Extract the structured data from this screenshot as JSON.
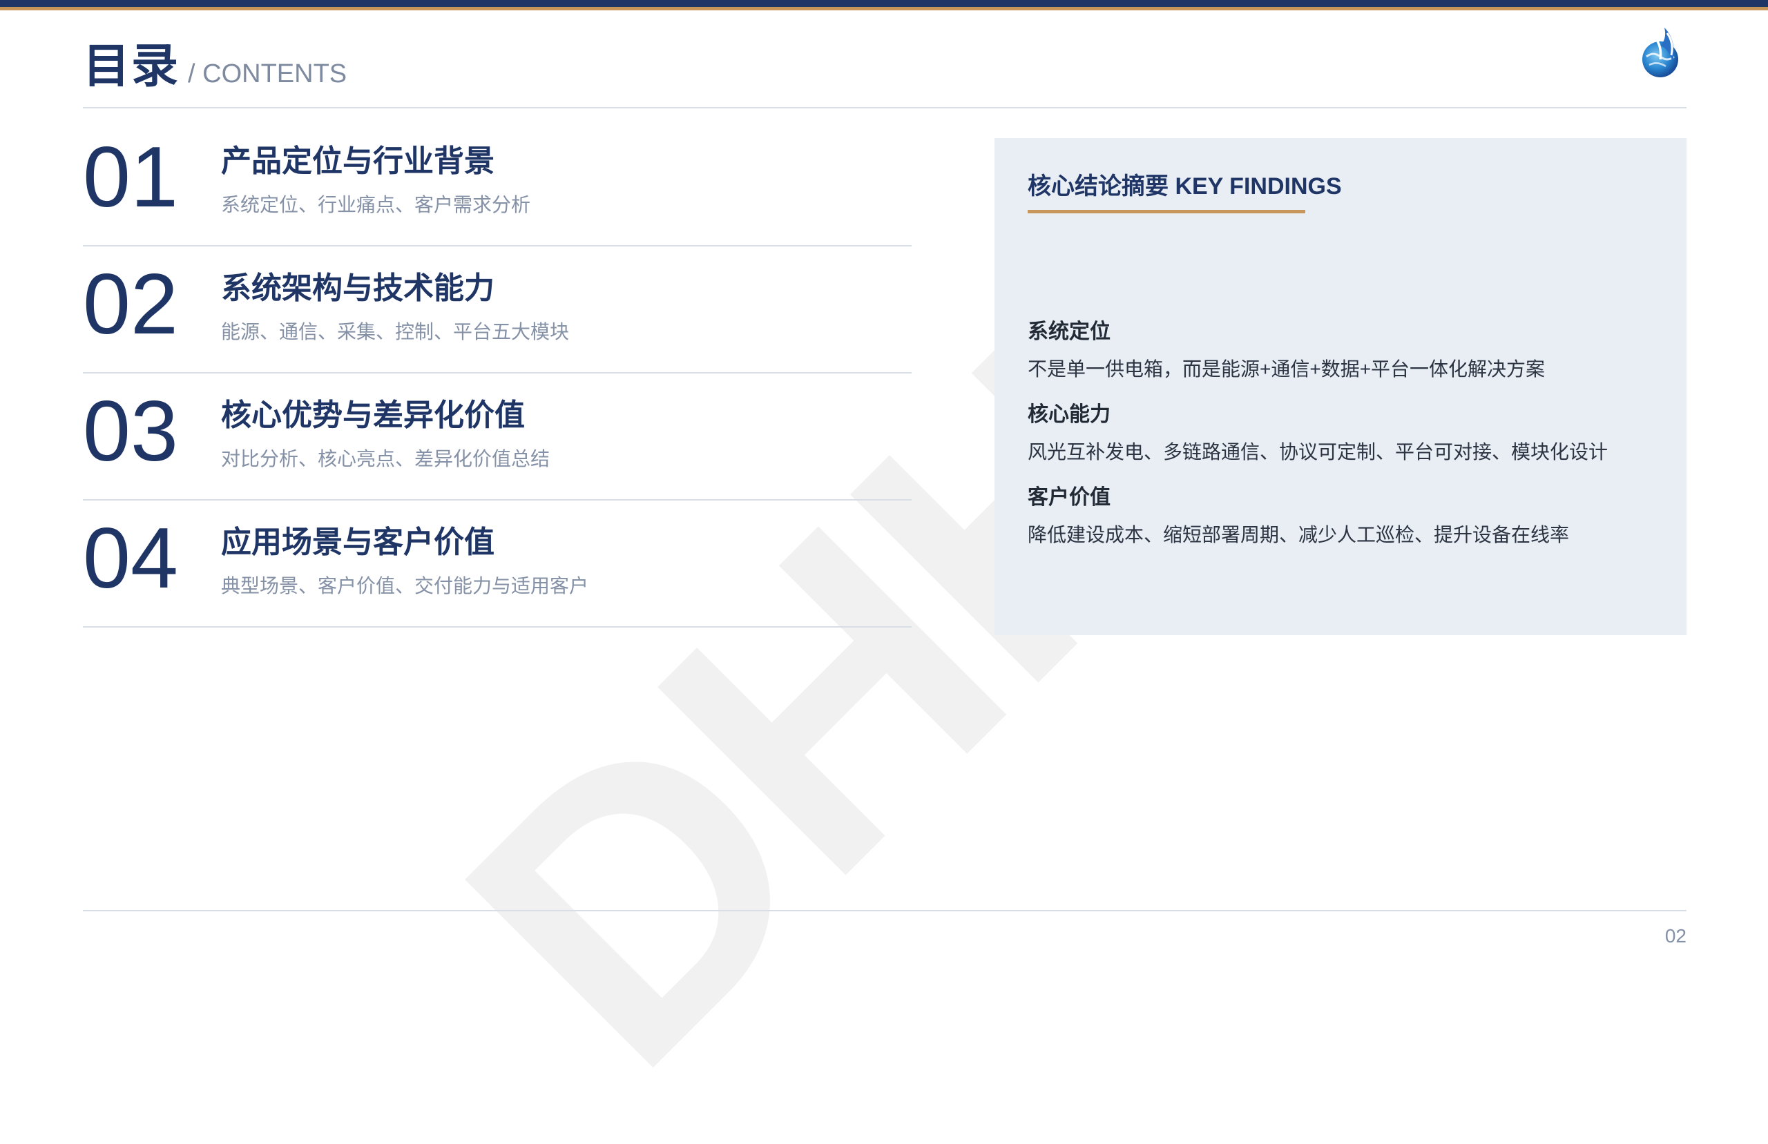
{
  "header": {
    "title": "目录",
    "subtitle": "/ CONTENTS"
  },
  "watermark": "DHHT",
  "toc": {
    "items": [
      {
        "number": "01",
        "title": "产品定位与行业背景",
        "desc": "系统定位、行业痛点、客户需求分析"
      },
      {
        "number": "02",
        "title": "系统架构与技术能力",
        "desc": "能源、通信、采集、控制、平台五大模块"
      },
      {
        "number": "03",
        "title": "核心优势与差异化价值",
        "desc": "对比分析、核心亮点、差异化价值总结"
      },
      {
        "number": "04",
        "title": "应用场景与客户价值",
        "desc": "典型场景、客户价值、交付能力与适用客户"
      }
    ]
  },
  "findings": {
    "title": "核心结论摘要 KEY FINDINGS",
    "items": [
      {
        "label": "系统定位",
        "text": "不是单一供电箱，而是能源+通信+数据+平台一体化解决方案"
      },
      {
        "label": "核心能力",
        "text": "风光互补发电、多链路通信、协议可定制、平台可对接、模块化设计"
      },
      {
        "label": "客户价值",
        "text": "降低建设成本、缩短部署周期、减少人工巡检、提升设备在线率"
      }
    ]
  },
  "footer": {
    "page_number": "02"
  },
  "colors": {
    "primary": "#1f3566",
    "accent": "#c8955a",
    "panel_bg": "#e9eef5",
    "muted": "#8591a6"
  },
  "icons": {
    "logo": "company-logo-icon"
  }
}
